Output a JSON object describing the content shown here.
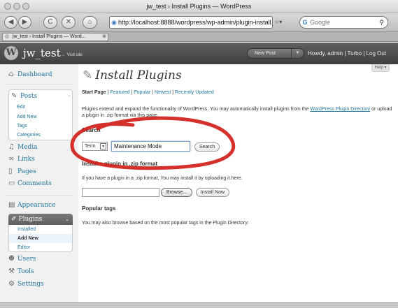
{
  "browser": {
    "window_title": "jw_test › Install Plugins — WordPress",
    "url": "http://localhost:8888/wordpress/wp-admin/plugin-install.p",
    "search_placeholder": "Google",
    "tab_title": "jw_test › Install Plugins — Word...",
    "back": "◀",
    "forward": "▶",
    "reload": "C",
    "stop": "✕",
    "home": "⌂"
  },
  "header": {
    "logo": "W",
    "site_name": "jw_test",
    "visit_site": "← Visit site",
    "new_post": "New Post",
    "new_post_arrow": "▼",
    "howdy": "Howdy, admin | Turbo | Log Out"
  },
  "sidebar": {
    "dashboard": "Dashboard",
    "posts": "Posts",
    "posts_sub": [
      "Edit",
      "Add New",
      "Tags",
      "Categories"
    ],
    "media": "Media",
    "links": "Links",
    "pages": "Pages",
    "comments": "Comments",
    "appearance": "Appearance",
    "plugins": "Plugins",
    "plugins_sub": [
      "Installed",
      "Add New",
      "Editor"
    ],
    "users": "Users",
    "tools": "Tools",
    "settings": "Settings"
  },
  "main": {
    "help": "Help ▾",
    "title": "Install Plugins",
    "tabs": {
      "start": "Start Page",
      "featured": "Featured",
      "popular": "Popular",
      "newest": "Newest",
      "recent": "Recently Updated"
    },
    "desc_pre": "Plugins extend and expand the functionality of WordPress. You may automatically install plugins from the ",
    "desc_link": "WordPress Plugin Directory",
    "desc_post": " or upload a plugin in .zip format via this page.",
    "search_heading": "Search",
    "search_type": "Term",
    "search_value": "Maintenance Mode",
    "search_button": "Search",
    "upload_heading": "Install a plugin in .zip format",
    "upload_text": "If you have a plugin in a .zip format, You may install it by uploading it here.",
    "browse_button": "Browse...",
    "install_button": "Install Now",
    "tags_heading": "Popular tags",
    "tags_text": "You may also browse based on the most popular tags in the Plugin Directory:"
  },
  "colors": {
    "link": "#21759b",
    "header": "#464646",
    "annotation": "#d0201a"
  }
}
